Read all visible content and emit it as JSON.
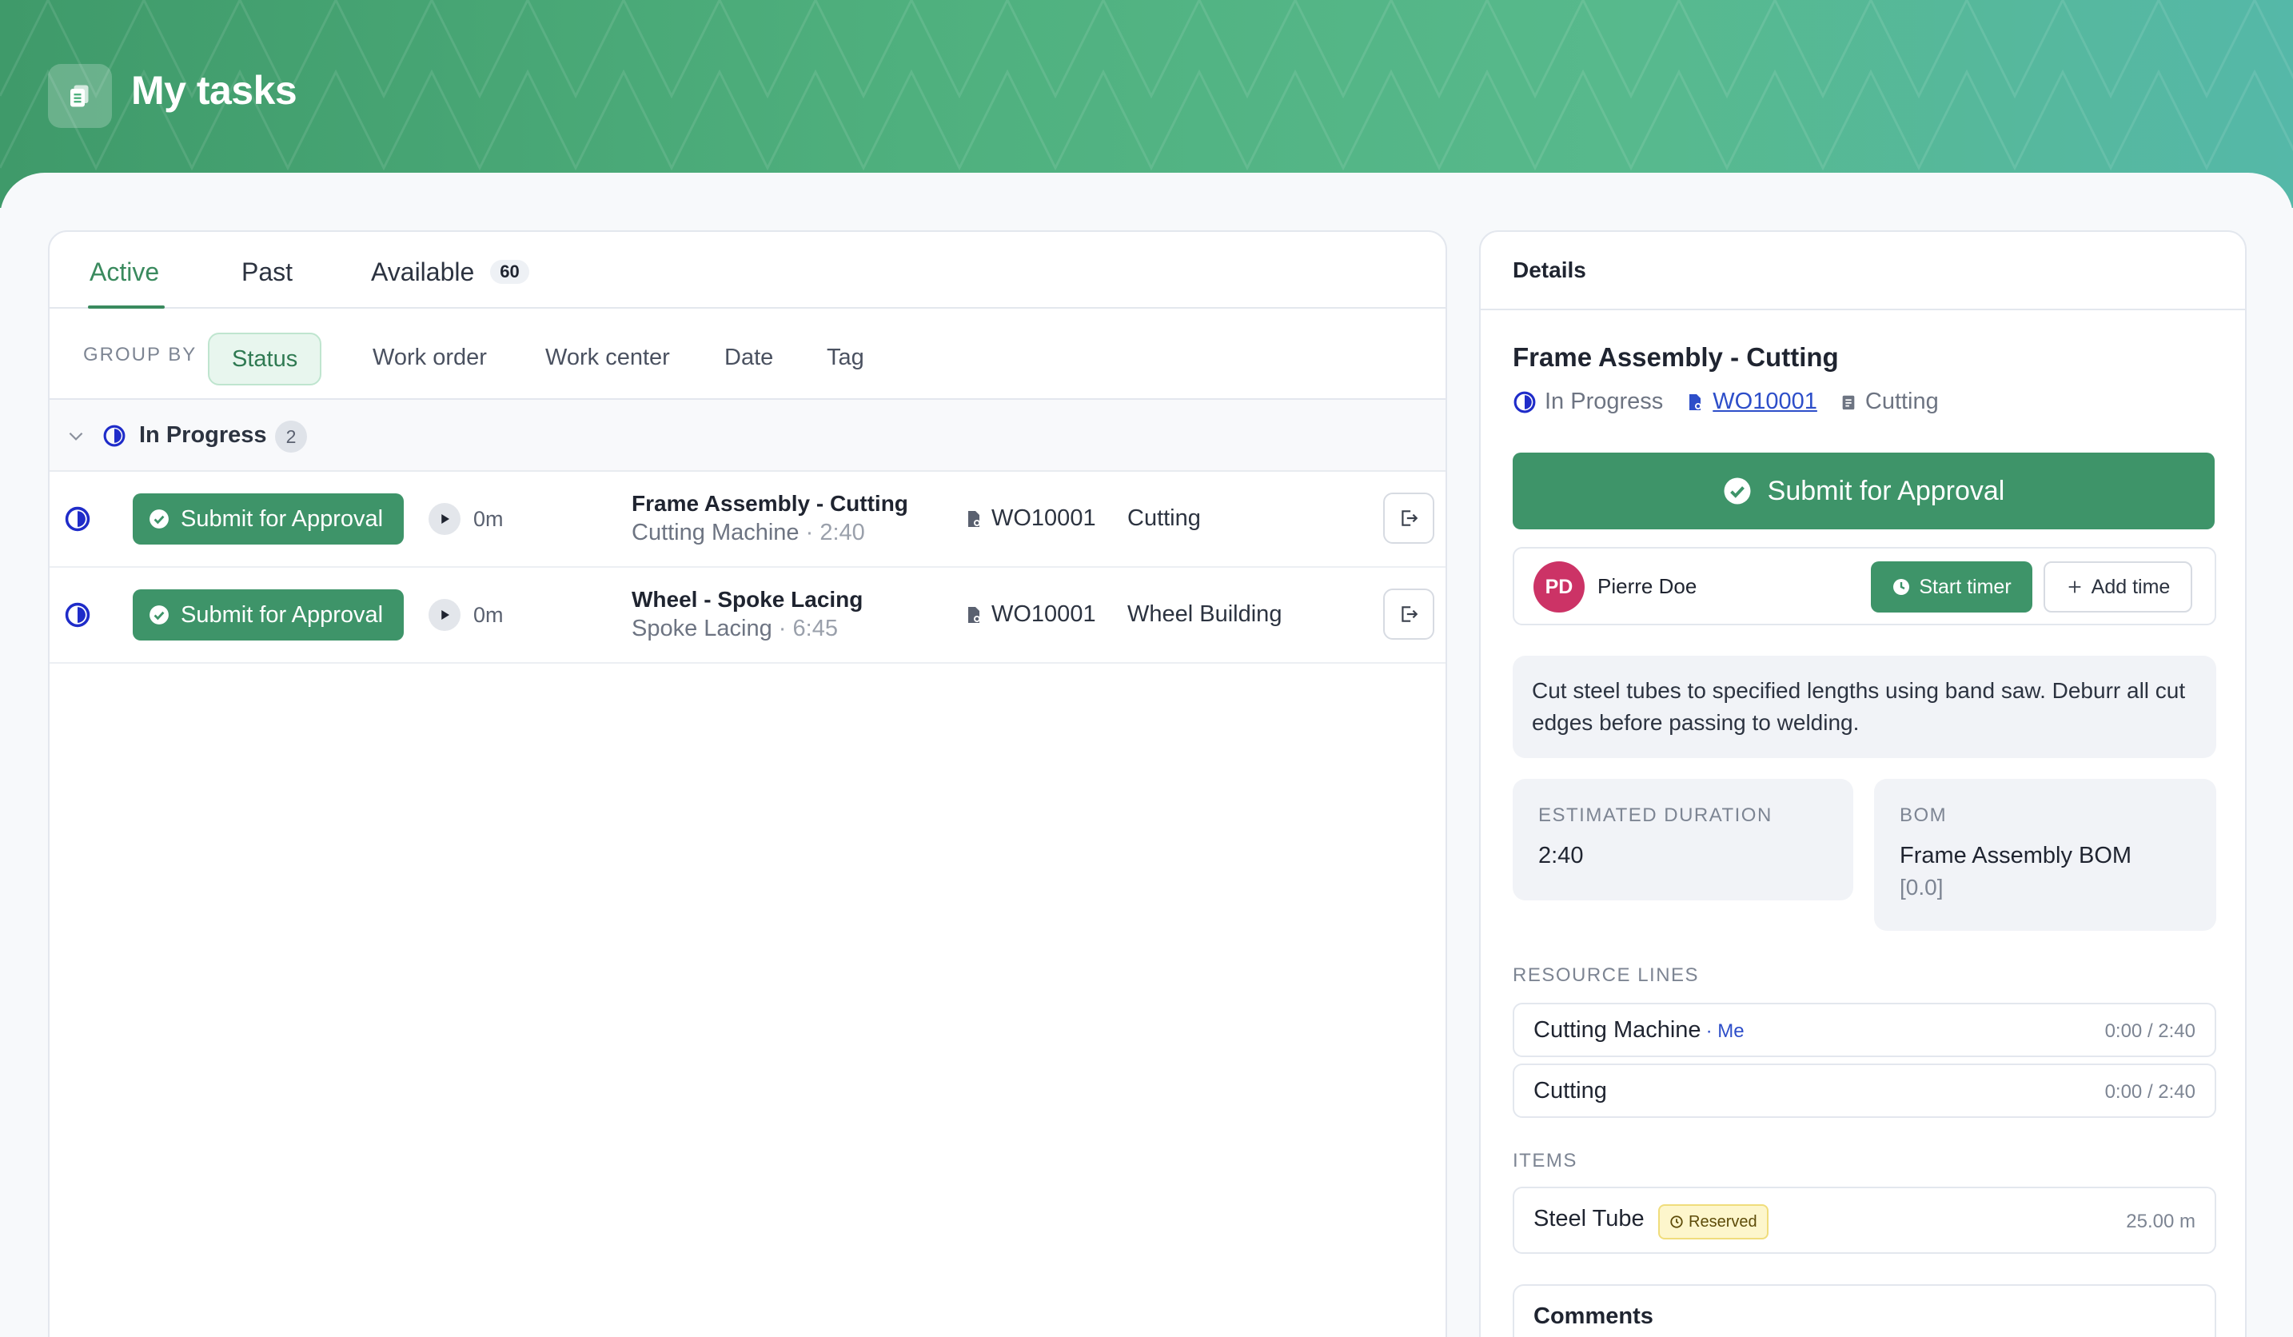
{
  "header": {
    "title": "My tasks"
  },
  "tabs": [
    {
      "label": "Active"
    },
    {
      "label": "Past"
    },
    {
      "label": "Available",
      "count": "60"
    }
  ],
  "group_by": {
    "label": "GROUP BY",
    "options": [
      "Status",
      "Work order",
      "Work center",
      "Date",
      "Tag"
    ],
    "selected": "Status"
  },
  "section": {
    "label": "In Progress",
    "count": "2"
  },
  "tasks": [
    {
      "action": "Submit for Approval",
      "duration": "0m",
      "title": "Frame Assembly - Cutting",
      "resource": "Cutting Machine",
      "time": "2:40",
      "work_order": "WO10001",
      "work_center": "Cutting"
    },
    {
      "action": "Submit for Approval",
      "duration": "0m",
      "title": "Wheel - Spoke Lacing",
      "resource": "Spoke Lacing",
      "time": "6:45",
      "work_order": "WO10001",
      "work_center": "Wheel Building"
    }
  ],
  "details": {
    "heading": "Details",
    "title": "Frame Assembly - Cutting",
    "status": "In Progress",
    "work_order": "WO10001",
    "work_center": "Cutting",
    "primary_action": "Submit for Approval",
    "assignee": {
      "initials": "PD",
      "name": "Pierre Doe"
    },
    "start_timer": "Start timer",
    "add_time": "Add time",
    "description": "Cut steel tubes to specified lengths using band saw. Deburr all cut edges before passing to welding.",
    "estimated_duration": {
      "label": "ESTIMATED DURATION",
      "value": "2:40"
    },
    "bom": {
      "label": "BOM",
      "value": "Frame Assembly BOM",
      "version": "[0.0]"
    },
    "resource_lines_label": "RESOURCE LINES",
    "resource_lines": [
      {
        "name": "Cutting Machine",
        "tag": "· Me",
        "time": "0:00 / 2:40"
      },
      {
        "name": "Cutting",
        "tag": "",
        "time": "0:00 / 2:40"
      }
    ],
    "items_label": "ITEMS",
    "items": [
      {
        "name": "Steel Tube",
        "badge": "Reserved",
        "qty": "25.00 m"
      }
    ],
    "comments_label": "Comments"
  },
  "colors": {
    "accent_green": "#3e9469",
    "link_blue": "#2d4ec9",
    "status_blue": "#1f2cc9",
    "avatar_pink": "#cc3366"
  }
}
